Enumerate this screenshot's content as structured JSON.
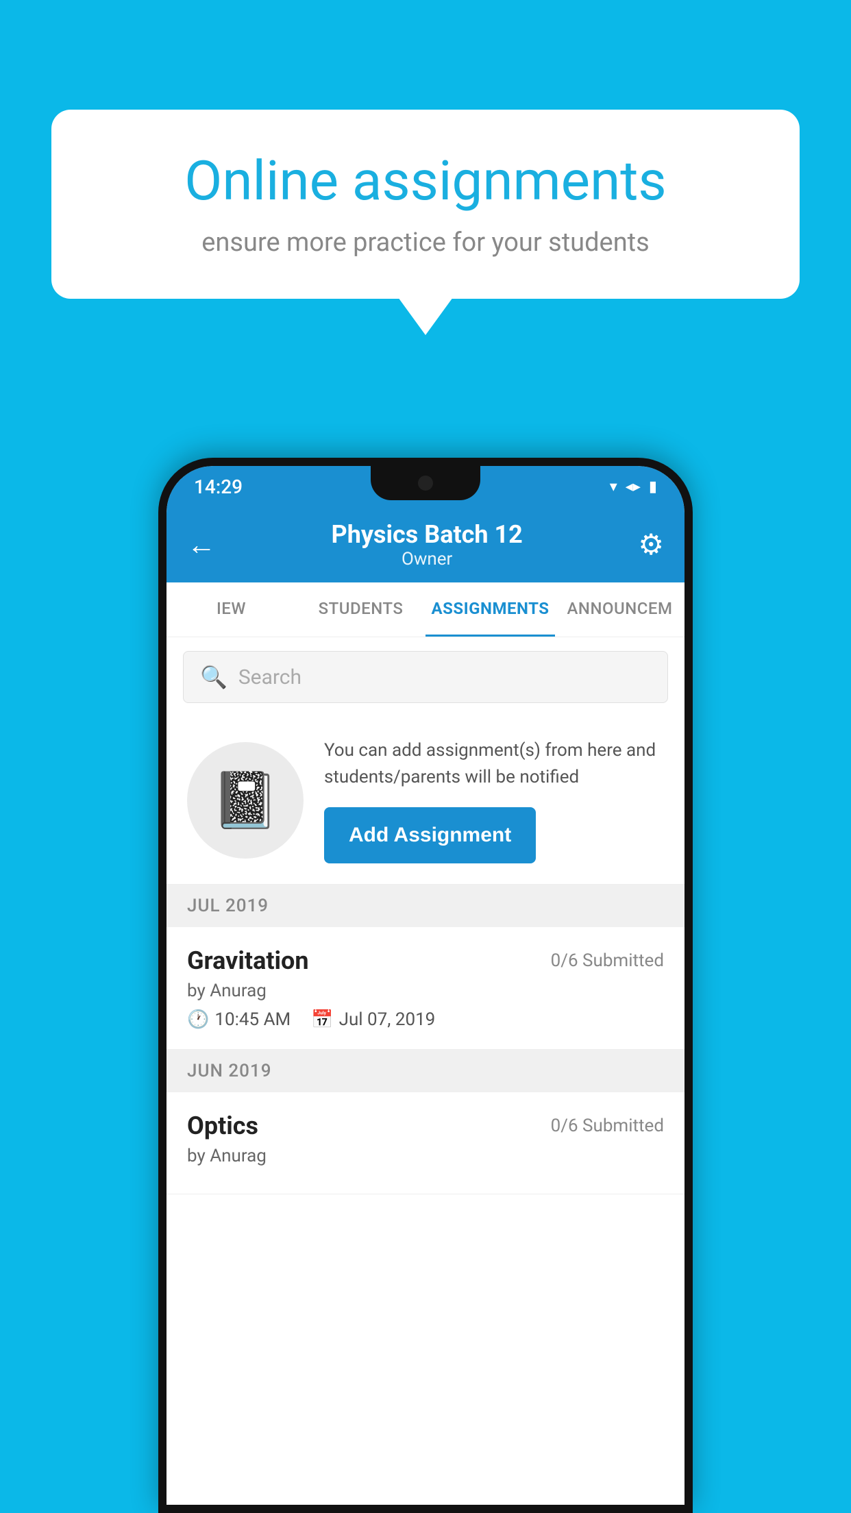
{
  "background_color": "#0BB8E8",
  "speech_bubble": {
    "title": "Online assignments",
    "subtitle": "ensure more practice for your students"
  },
  "status_bar": {
    "time": "14:29",
    "icons": [
      "wifi",
      "signal",
      "battery"
    ]
  },
  "app_header": {
    "title": "Physics Batch 12",
    "subtitle": "Owner",
    "back_label": "←",
    "settings_label": "⚙"
  },
  "tabs": [
    {
      "label": "IEW",
      "active": false
    },
    {
      "label": "STUDENTS",
      "active": false
    },
    {
      "label": "ASSIGNMENTS",
      "active": true
    },
    {
      "label": "ANNOUNCEM",
      "active": false
    }
  ],
  "search": {
    "placeholder": "Search"
  },
  "promo": {
    "description": "You can add assignment(s) from here and students/parents will be notified",
    "button_label": "Add Assignment"
  },
  "months": [
    {
      "label": "JUL 2019",
      "assignments": [
        {
          "name": "Gravitation",
          "submitted": "0/6 Submitted",
          "by": "by Anurag",
          "time": "10:45 AM",
          "date": "Jul 07, 2019"
        }
      ]
    },
    {
      "label": "JUN 2019",
      "assignments": [
        {
          "name": "Optics",
          "submitted": "0/6 Submitted",
          "by": "by Anurag",
          "time": "",
          "date": ""
        }
      ]
    }
  ]
}
